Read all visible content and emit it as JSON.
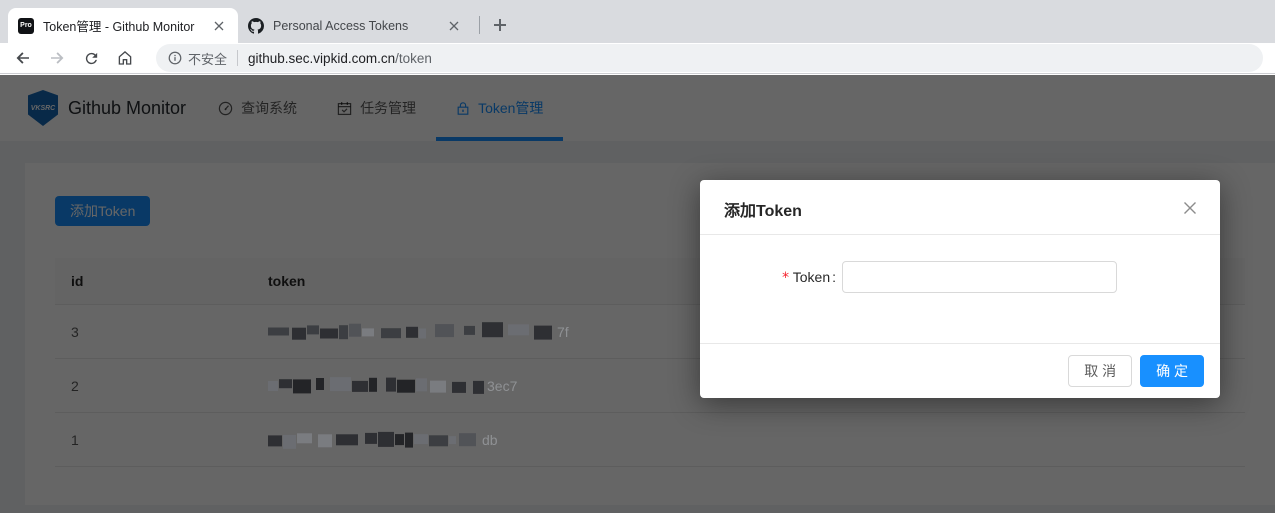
{
  "browser": {
    "tabs": [
      {
        "title": "Token管理 - Github Monitor",
        "favicon": "pro-badge",
        "favicon_text": "Pro",
        "active": true
      },
      {
        "title": "Personal Access Tokens",
        "favicon": "github-logo",
        "active": false
      }
    ],
    "url": {
      "security_label": "不安全",
      "host": "github.sec.vipkid.com.cn",
      "path": "/token"
    }
  },
  "app": {
    "logo_text": "VKSRC",
    "title": "Github Monitor",
    "nav": [
      {
        "label": "查询系统",
        "icon": "dashboard-icon",
        "active": false
      },
      {
        "label": "任务管理",
        "icon": "calendar-icon",
        "active": false
      },
      {
        "label": "Token管理",
        "icon": "lock-icon",
        "active": true
      }
    ],
    "add_button_label": "添加Token",
    "table": {
      "columns": [
        "id",
        "token"
      ],
      "rows": [
        {
          "id": "3",
          "token_redacted": true,
          "token_visible_suffix": "7f"
        },
        {
          "id": "2",
          "token_redacted": true,
          "token_visible_suffix": "3ec7"
        },
        {
          "id": "1",
          "token_redacted": true,
          "token_visible_suffix": "db"
        }
      ]
    }
  },
  "modal": {
    "title": "添加Token",
    "form": {
      "required_mark": "*",
      "label": "Token",
      "colon": ":",
      "input_value": "",
      "input_placeholder": ""
    },
    "cancel_label": "取 消",
    "ok_label": "确 定"
  },
  "colors": {
    "accent": "#1890ff",
    "danger": "#f5222d",
    "mask": "rgba(0,0,0,0.6)"
  }
}
